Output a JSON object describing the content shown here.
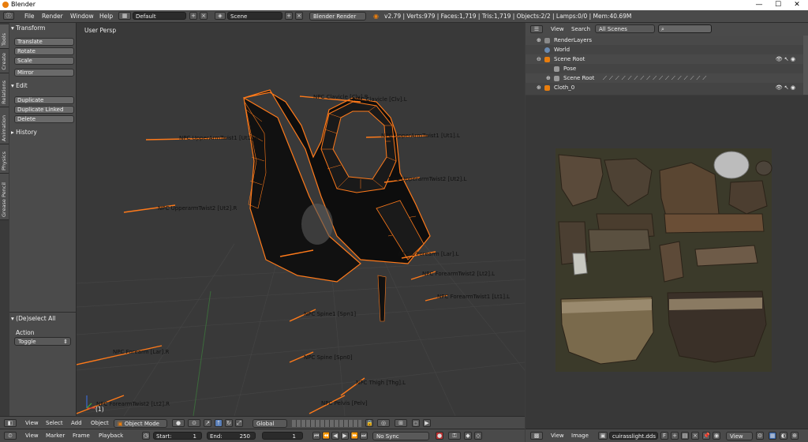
{
  "window": {
    "title": "Blender",
    "minimize": "—",
    "maximize": "☐",
    "close": "✕"
  },
  "menubar": {
    "items": [
      "File",
      "Render",
      "Window",
      "Help"
    ],
    "layout_field": "Default",
    "scene_field": "Scene",
    "render_engine": "Blender Render",
    "stats": "v2.79 | Verts:979 | Faces:1,719 | Tris:1,719 | Objects:2/2 | Lamps:0/0 | Mem:40.69M"
  },
  "tool_tabs": [
    "Tools",
    "Create",
    "Relations",
    "Animation",
    "Physics",
    "Grease Pencil"
  ],
  "tool_shelf": {
    "transform": {
      "header": "Transform",
      "buttons": [
        "Translate",
        "Rotate",
        "Scale",
        "Mirror"
      ]
    },
    "edit": {
      "header": "Edit",
      "buttons": [
        "Duplicate",
        "Duplicate Linked",
        "Delete"
      ]
    },
    "history": {
      "header": "History"
    },
    "operator": {
      "header": "(De)select All",
      "action_label": "Action",
      "action_value": "Toggle"
    }
  },
  "viewport": {
    "view_name": "User Persp",
    "frame_indicator": "(1)",
    "bone_labels": [
      "NPC Clavicle [Clv].R",
      "NPC Clavicle [Clv].L",
      "NPC UpperArmTwist1 [Ut1].R",
      "NPC UpperArmTwist1 [Ut1].L",
      "NPC UpperarmTwist2 [Ut2].L",
      "NPC UpperarmTwist2 [Ut2].R",
      "NPC L Forearm [Lar].L",
      "NPC ForearmTwist2 [Lt2].L",
      "NPC ForearmTwist1 [Lt1].L",
      "NPC Spine1 [Spn1]",
      "NPC Forearm [Lar].R",
      "NPC Spine [Spn0]",
      "NPC Thigh [Thg].L",
      "NPC ForearmTwist2 [Lt2].R",
      "NPC Pelvis [Pelv]"
    ]
  },
  "viewport_header": {
    "menus": [
      "View",
      "Select",
      "Add",
      "Object"
    ],
    "mode": "Object Mode",
    "orientation": "Global"
  },
  "timeline": {
    "menus": [
      "View",
      "Marker",
      "Frame",
      "Playback"
    ],
    "start_label": "Start:",
    "start_value": "1",
    "end_label": "End:",
    "end_value": "250",
    "current_frame": "1",
    "sync": "No Sync"
  },
  "outliner": {
    "menus": [
      "View",
      "Search"
    ],
    "filter": "All Scenes",
    "rows": [
      "RenderLayers",
      "World",
      "Scene Root",
      "Pose",
      "Scene Root",
      "Cloth_0"
    ]
  },
  "image_editor": {
    "menus": [
      "View",
      "Image"
    ],
    "image_name": "cuirasslight.dds",
    "view_menu": "View"
  },
  "colors": {
    "accent": "#e87d0d",
    "wire": "#ff7a1a",
    "bg": "#393939"
  }
}
